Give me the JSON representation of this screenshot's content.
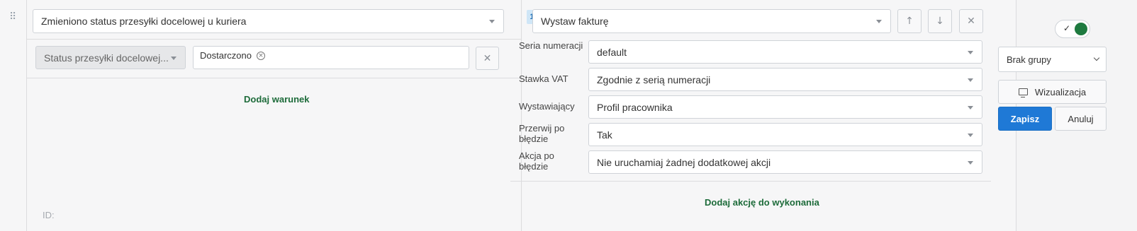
{
  "trigger": {
    "value": "Zmieniono status przesyłki docelowej u kuriera"
  },
  "condition": {
    "field_value": "Status przesyłki docelowej...",
    "tag_value": "Dostarczono",
    "remove_icon": "close-circle-icon",
    "delete_icon": "close-icon"
  },
  "add_condition_label": "Dodaj warunek",
  "id_label": "ID:",
  "action": {
    "step_number": "1.",
    "type_value": "Wystaw fakturę",
    "move_up_icon": "arrow-up-icon",
    "move_down_icon": "arrow-down-icon",
    "delete_icon": "close-icon",
    "fields": [
      {
        "label": "Seria numeracji",
        "value": "default"
      },
      {
        "label": "Stawka VAT",
        "value": "Zgodnie z serią numeracji"
      },
      {
        "label": "Wystawiający",
        "value": "Profil pracownika"
      },
      {
        "label": "Przerwij po błędzie",
        "value": "Tak"
      },
      {
        "label": "Akcja po błędzie",
        "value": "Nie uruchamiaj żadnej dodatkowej akcji"
      }
    ]
  },
  "add_action_label": "Dodaj akcję do wykonania",
  "settings": {
    "active": true,
    "group_value": "Brak grupy",
    "visualization_label": "Wizualizacja",
    "visualization_icon": "monitor-icon",
    "save_label": "Zapisz",
    "cancel_label": "Anuluj"
  },
  "colors": {
    "primary": "#1f79d6",
    "link_green": "#1d6b3a",
    "toggle_on": "#1e7a3f",
    "step_badge_bg": "#cfe6f7"
  }
}
